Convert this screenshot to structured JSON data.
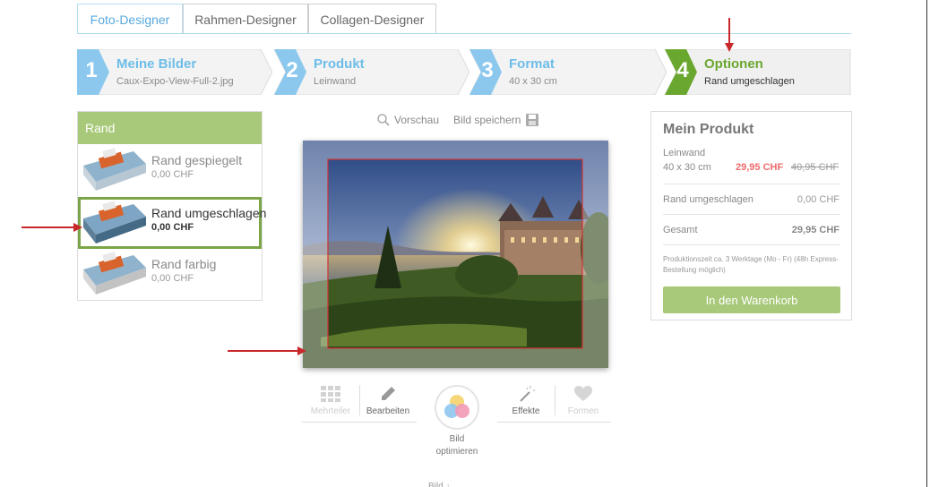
{
  "tabs": [
    {
      "label": "Foto-Designer",
      "active": true
    },
    {
      "label": "Rahmen-Designer",
      "active": false
    },
    {
      "label": "Collagen-Designer",
      "active": false
    }
  ],
  "steps": [
    {
      "number": "1",
      "title": "Meine Bilder",
      "subtitle": "Caux-Expo-View-Full-2.jpg"
    },
    {
      "number": "2",
      "title": "Produkt",
      "subtitle": "Leinwand"
    },
    {
      "number": "3",
      "title": "Format",
      "subtitle": "40 x 30 cm"
    },
    {
      "number": "4",
      "title": "Optionen",
      "subtitle": "Rand umgeschlagen"
    }
  ],
  "rand": {
    "header": "Rand",
    "items": [
      {
        "name": "Rand gespiegelt",
        "price": "0,00 CHF",
        "selected": false
      },
      {
        "name": "Rand umgeschlagen",
        "price": "0,00 CHF",
        "selected": true
      },
      {
        "name": "Rand farbig",
        "price": "0,00 CHF",
        "selected": false
      }
    ]
  },
  "preview_bar": {
    "preview": "Vorschau",
    "save": "Bild speichern"
  },
  "tools": {
    "mehrteiler": "Mehrteiler",
    "bearbeiten": "Bearbeiten",
    "optimize_line1": "Bild",
    "optimize_line2": "optimieren",
    "effekte": "Effekte",
    "formen": "Formen"
  },
  "product": {
    "title": "Mein Produkt",
    "type": "Leinwand",
    "size": "40 x 30 cm",
    "price_now": "29,95 CHF",
    "price_old": "40,95 CHF",
    "rand_label": "Rand umgeschlagen",
    "rand_price": "0,00 CHF",
    "total_label": "Gesamt",
    "total_price": "29,95 CHF",
    "note": "Produktionszeit ca. 3 Werktage (Mo - Fr) (48h Express-Bestellung möglich)",
    "cart_button": "In den Warenkorb"
  },
  "bottom_text": "Bild ↓",
  "colors": {
    "blue": "#5aa9df",
    "green": "#7aa548",
    "green_light": "#a8c97a",
    "red_price": "#ef6a6a",
    "annotation_red": "#c8282a"
  }
}
